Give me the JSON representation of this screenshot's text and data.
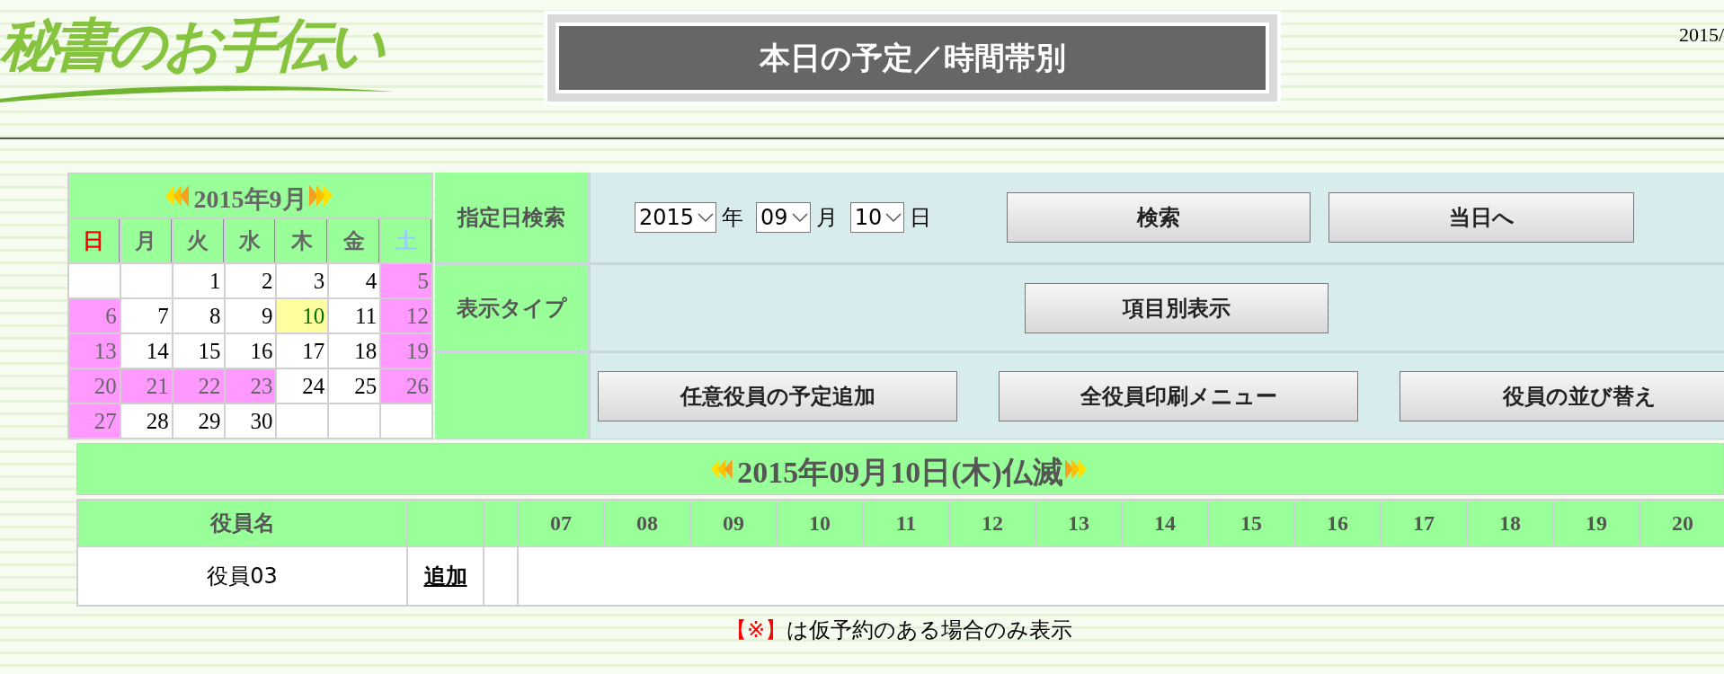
{
  "logo": "秘書のお手伝い",
  "title": "本日の予定／時間帯別",
  "date_corner": "2015/",
  "calendar": {
    "month": "2015年9月",
    "weekdays": [
      {
        "label": "日",
        "kind": "sunday"
      },
      {
        "label": "月",
        "kind": "weekday"
      },
      {
        "label": "火",
        "kind": "weekday"
      },
      {
        "label": "水",
        "kind": "weekday"
      },
      {
        "label": "木",
        "kind": "weekday"
      },
      {
        "label": "金",
        "kind": "weekday"
      },
      {
        "label": "土",
        "kind": "saturday"
      }
    ],
    "weeks": [
      [
        {
          "kind": "blank"
        },
        {
          "kind": "blank"
        },
        {
          "day": "1",
          "kind": "normal"
        },
        {
          "day": "2",
          "kind": "normal"
        },
        {
          "day": "3",
          "kind": "normal"
        },
        {
          "day": "4",
          "kind": "normal"
        },
        {
          "day": "5",
          "kind": "holiday"
        }
      ],
      [
        {
          "day": "6",
          "kind": "holiday"
        },
        {
          "day": "7",
          "kind": "normal"
        },
        {
          "day": "8",
          "kind": "normal"
        },
        {
          "day": "9",
          "kind": "normal"
        },
        {
          "day": "10",
          "kind": "today"
        },
        {
          "day": "11",
          "kind": "normal"
        },
        {
          "day": "12",
          "kind": "holiday"
        }
      ],
      [
        {
          "day": "13",
          "kind": "holiday"
        },
        {
          "day": "14",
          "kind": "normal"
        },
        {
          "day": "15",
          "kind": "normal"
        },
        {
          "day": "16",
          "kind": "normal"
        },
        {
          "day": "17",
          "kind": "normal"
        },
        {
          "day": "18",
          "kind": "normal"
        },
        {
          "day": "19",
          "kind": "holiday"
        }
      ],
      [
        {
          "day": "20",
          "kind": "holiday"
        },
        {
          "day": "21",
          "kind": "holiday"
        },
        {
          "day": "22",
          "kind": "holiday"
        },
        {
          "day": "23",
          "kind": "holiday"
        },
        {
          "day": "24",
          "kind": "normal"
        },
        {
          "day": "25",
          "kind": "normal"
        },
        {
          "day": "26",
          "kind": "holiday"
        }
      ],
      [
        {
          "day": "27",
          "kind": "holiday"
        },
        {
          "day": "28",
          "kind": "normal"
        },
        {
          "day": "29",
          "kind": "normal"
        },
        {
          "day": "30",
          "kind": "normal"
        },
        {
          "kind": "blank"
        },
        {
          "kind": "blank"
        },
        {
          "kind": "blank"
        }
      ]
    ]
  },
  "search": {
    "label": "指定日検索",
    "year": "2015",
    "year_unit": "年",
    "month": "09",
    "month_unit": "月",
    "day": "10",
    "day_unit": "日",
    "buttons": [
      "検索",
      "当日へ"
    ]
  },
  "display_type": {
    "label": "表示タイプ",
    "button": "項目別表示"
  },
  "actions": [
    "任意役員の予定追加",
    "全役員印刷メニュー",
    "役員の並び替え"
  ],
  "day_header": "2015年09月10日(木)仏滅",
  "table": {
    "columns": [
      "役員名",
      "07",
      "08",
      "09",
      "10",
      "11",
      "12",
      "13",
      "14",
      "15",
      "16",
      "17",
      "18",
      "19",
      "20"
    ],
    "rows": [
      {
        "name": "役員03",
        "link": "追加"
      }
    ]
  },
  "note": {
    "mark": "【※】",
    "text": "は仮予約のある場合のみ表示"
  }
}
